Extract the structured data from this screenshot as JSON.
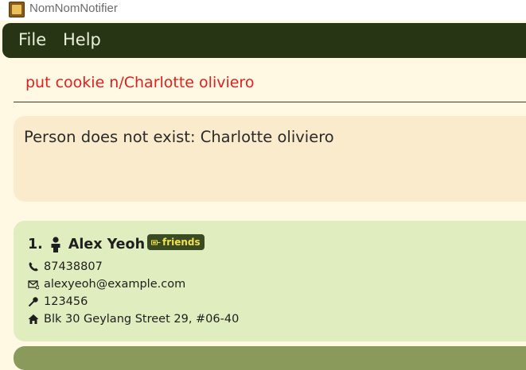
{
  "window": {
    "title": "NomNomNotifier"
  },
  "menu": {
    "items": [
      "File",
      "Help"
    ]
  },
  "command_box": {
    "value": "put cookie n/Charlotte oliviero"
  },
  "result": {
    "message": "Person does not exist: Charlotte oliviero"
  },
  "persons": [
    {
      "index": "1.",
      "name": "Alex Yeoh",
      "tag": "friends",
      "tag_icon_text": "▭⃞",
      "phone": "87438807",
      "email": "alexyeoh@example.com",
      "postal": "123456",
      "address": "Blk 30 Geylang Street 29, #06-40"
    }
  ],
  "colors": {
    "menubar": "#273515",
    "command_text": "#E02020",
    "result_background": "#FAEBCD",
    "card_background": "#E0EDBE",
    "tag_background": "#3A4A22",
    "tag_text": "#F2E24A"
  },
  "icons": [
    "app-icon",
    "person-icon",
    "tag-icon",
    "phone-icon",
    "email-icon",
    "postal-icon",
    "home-icon"
  ]
}
